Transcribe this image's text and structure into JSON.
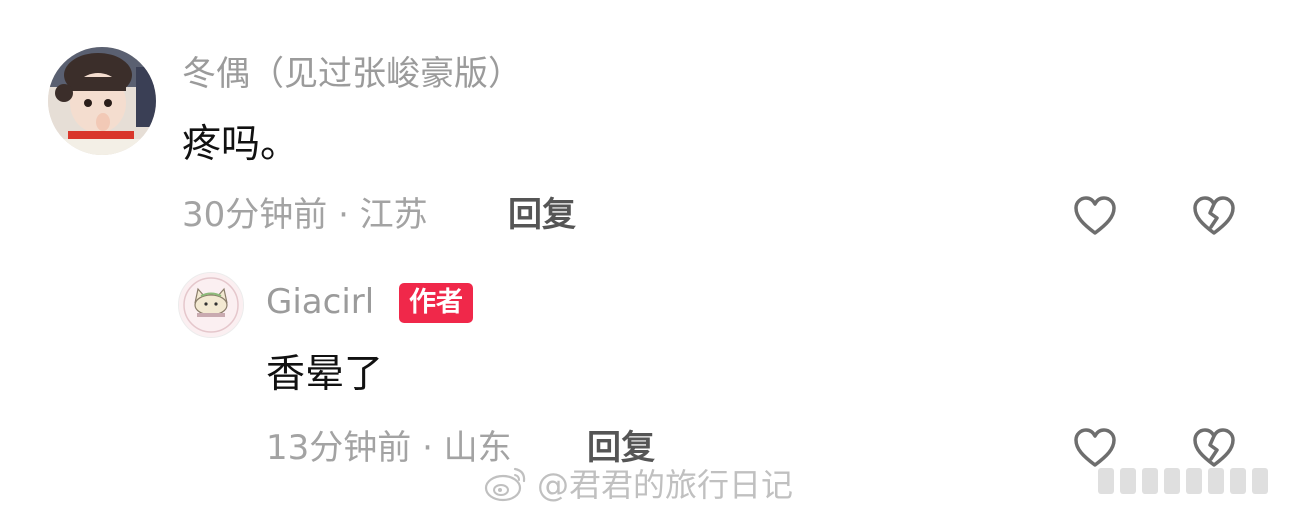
{
  "comment": {
    "username": "冬偶（见过张峻豪版）",
    "text": "疼吗。",
    "meta": "30分钟前 · 江苏",
    "reply_label": "回复"
  },
  "reply": {
    "username": "Giacirl",
    "author_badge": "作者",
    "text": "香晕了",
    "meta": "13分钟前 · 山东",
    "reply_label": "回复"
  },
  "watermark": {
    "text": "@君君的旅行日记",
    "logo_icon": "weibo-logo-icon"
  },
  "colors": {
    "badge": "#f0284a",
    "meta_gray": "#a3a3a3",
    "username_gray": "#9b9b9b",
    "icon_gray": "#6e6e6e"
  }
}
